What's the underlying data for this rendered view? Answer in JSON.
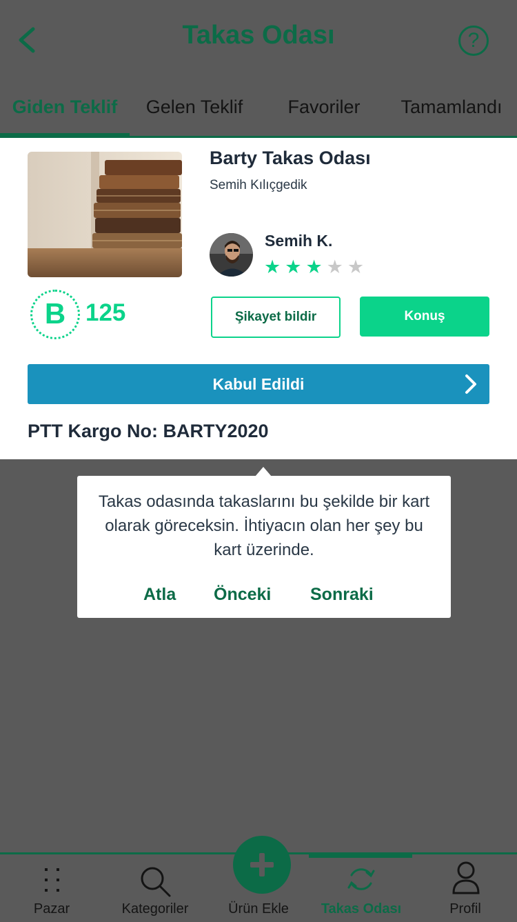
{
  "header": {
    "title": "Takas Odası",
    "help_icon": "question-icon"
  },
  "tabs": [
    {
      "label": "Giden Teklif",
      "active": true
    },
    {
      "label": "Gelen Teklif",
      "active": false
    },
    {
      "label": "Favoriler",
      "active": false
    },
    {
      "label": "Tamamlandı",
      "active": false
    }
  ],
  "card": {
    "title": "Barty Takas Odası",
    "owner": "Semih Kılıçgedik",
    "user_name": "Semih K.",
    "rating": 3,
    "rating_max": 5,
    "coin_letter": "B",
    "coin_value": "125",
    "complain_label": "Şikayet bildir",
    "talk_label": "Konuş",
    "status_label": "Kabul Edildi",
    "cargo_label": "PTT Kargo No: BARTY2020"
  },
  "tooltip": {
    "text": "Takas odasında takaslarını bu şekilde bir kart olarak göreceksin. İhtiyacın olan her şey bu kart üzerinde.",
    "skip_label": "Atla",
    "prev_label": "Önceki",
    "next_label": "Sonraki"
  },
  "bottom_nav": [
    {
      "label": "Pazar",
      "icon": "grid-icon",
      "active": false
    },
    {
      "label": "Kategoriler",
      "icon": "search-icon",
      "active": false
    },
    {
      "label": "Ürün Ekle",
      "icon": "plus-icon",
      "active": false
    },
    {
      "label": "Takas Odası",
      "icon": "swap-icon",
      "active": true
    },
    {
      "label": "Profil",
      "icon": "user-icon",
      "active": false
    }
  ],
  "colors": {
    "brand_dark": "#0c6b47",
    "brand_green": "#0bd38a",
    "status_blue": "#1a92bd",
    "overlay": "#5a5a5a"
  }
}
